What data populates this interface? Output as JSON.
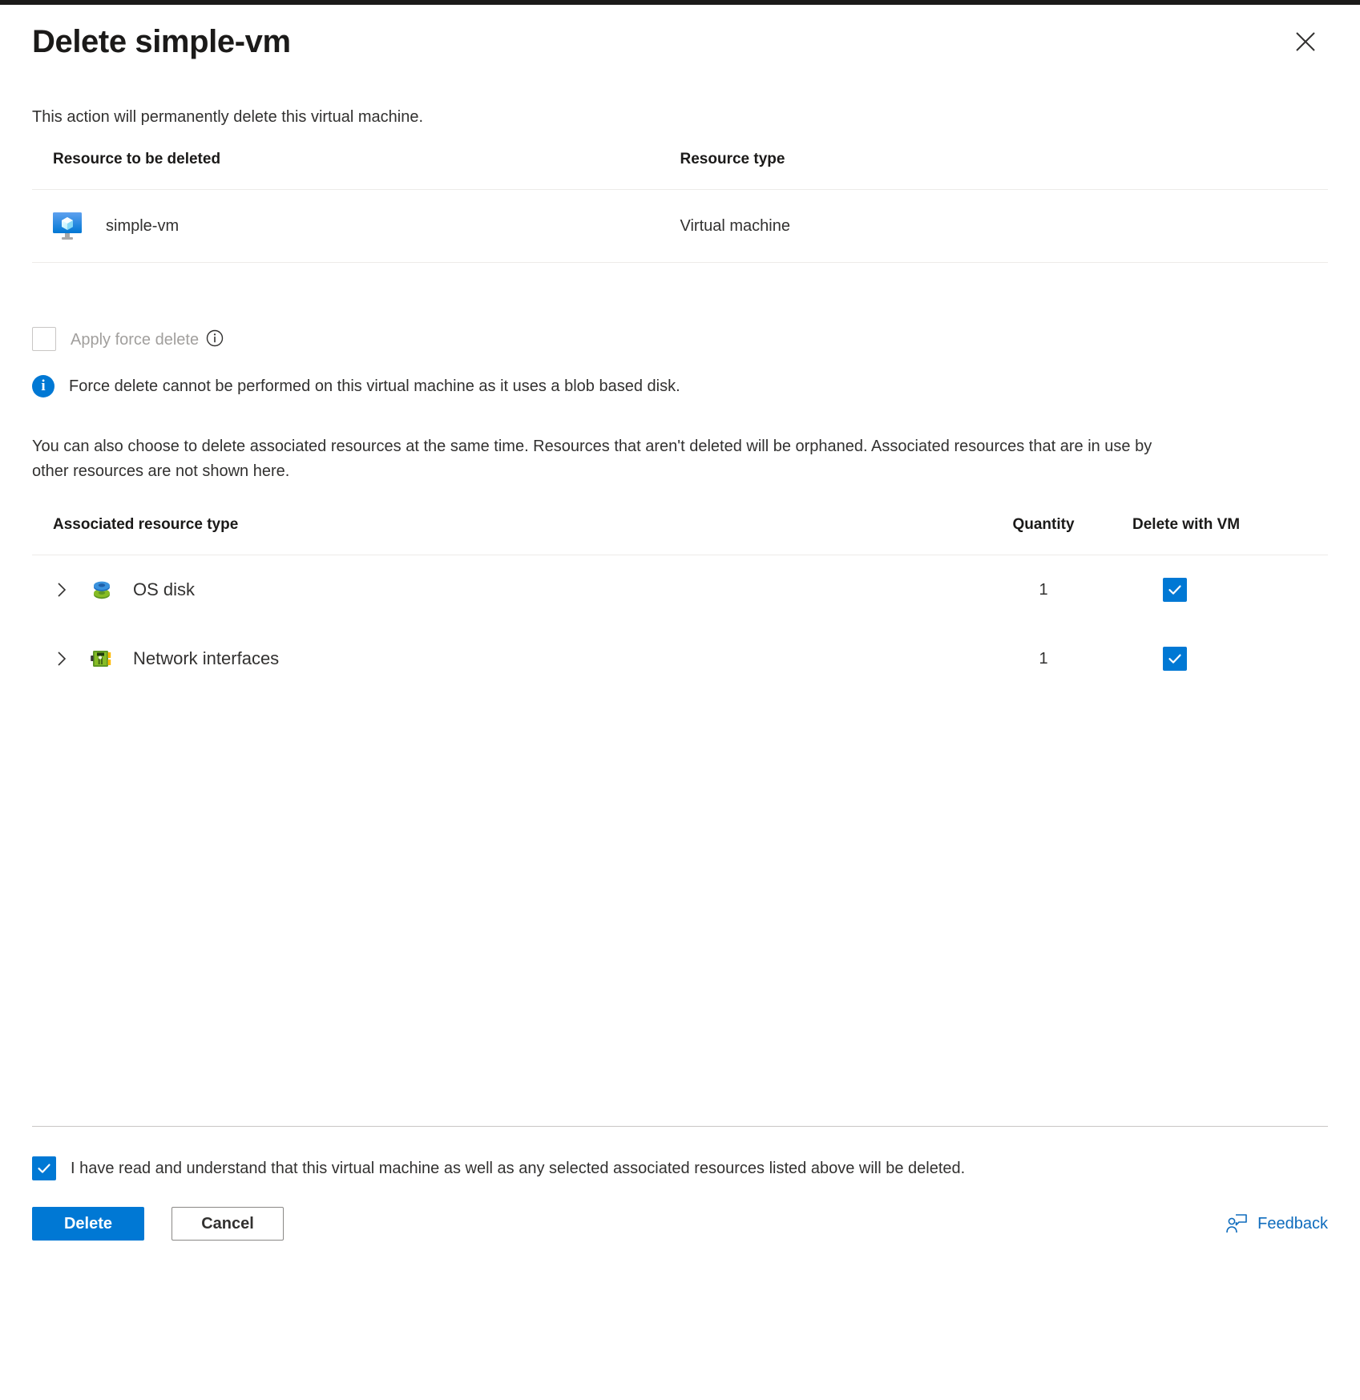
{
  "dialog": {
    "title": "Delete simple-vm",
    "close_icon": "close-icon",
    "intro": "This action will permanently delete this virtual machine."
  },
  "resource_table": {
    "headers": {
      "name": "Resource to be deleted",
      "type": "Resource type"
    },
    "rows": [
      {
        "icon": "virtual-machine-icon",
        "name": "simple-vm",
        "type": "Virtual machine"
      }
    ]
  },
  "force_delete": {
    "label": "Apply force delete",
    "checked": false,
    "disabled": true,
    "info_icon": "info-circle-icon"
  },
  "info_message": {
    "icon": "info-filled-icon",
    "icon_glyph": "i",
    "text": "Force delete cannot be performed on this virtual machine as it uses a blob based disk."
  },
  "associated_intro": "You can also choose to delete associated resources at the same time. Resources that aren't deleted will be orphaned. Associated resources that are in use by other resources are not shown here.",
  "associated_table": {
    "headers": {
      "type": "Associated resource type",
      "quantity": "Quantity",
      "delete_with_vm": "Delete with VM"
    },
    "rows": [
      {
        "expand_icon": "chevron-right-icon",
        "icon": "os-disk-icon",
        "label": "OS disk",
        "quantity": "1",
        "checked": true
      },
      {
        "expand_icon": "chevron-right-icon",
        "icon": "network-interface-icon",
        "label": "Network interfaces",
        "quantity": "1",
        "checked": true
      }
    ]
  },
  "acknowledgement": {
    "checked": true,
    "text": "I have read and understand that this virtual machine as well as any selected associated resources listed above will be deleted."
  },
  "actions": {
    "delete_label": "Delete",
    "cancel_label": "Cancel",
    "feedback_label": "Feedback",
    "feedback_icon": "feedback-person-icon"
  },
  "colors": {
    "accent": "#0078d4",
    "link": "#0f6cbd",
    "text": "#323130",
    "disabled_text": "#a19f9d",
    "border": "#edebe9"
  }
}
